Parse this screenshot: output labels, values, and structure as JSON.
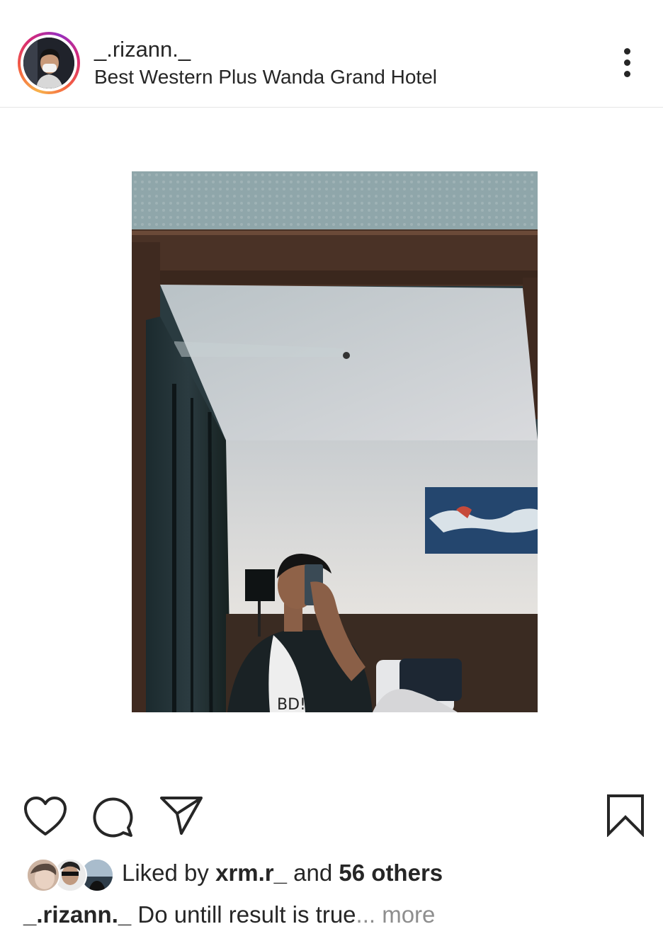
{
  "post": {
    "username": "_.rizann._",
    "location": "Best Western Plus Wanda Grand Hotel"
  },
  "likes": {
    "prefix": "Liked by",
    "first_liker": "xrm.r_",
    "connector": "and",
    "others": "56 others"
  },
  "caption": {
    "username": "_.rizann._",
    "text": "Do untill result is true",
    "ellipsis": "...",
    "more_label": "more"
  },
  "icons": {
    "more": "more-vertical-icon",
    "like": "heart-icon",
    "comment": "comment-icon",
    "share": "paper-plane-icon",
    "save": "bookmark-icon"
  },
  "colors": {
    "text": "#262626",
    "muted": "#8e8e8e",
    "divider": "#e6e6e6"
  }
}
